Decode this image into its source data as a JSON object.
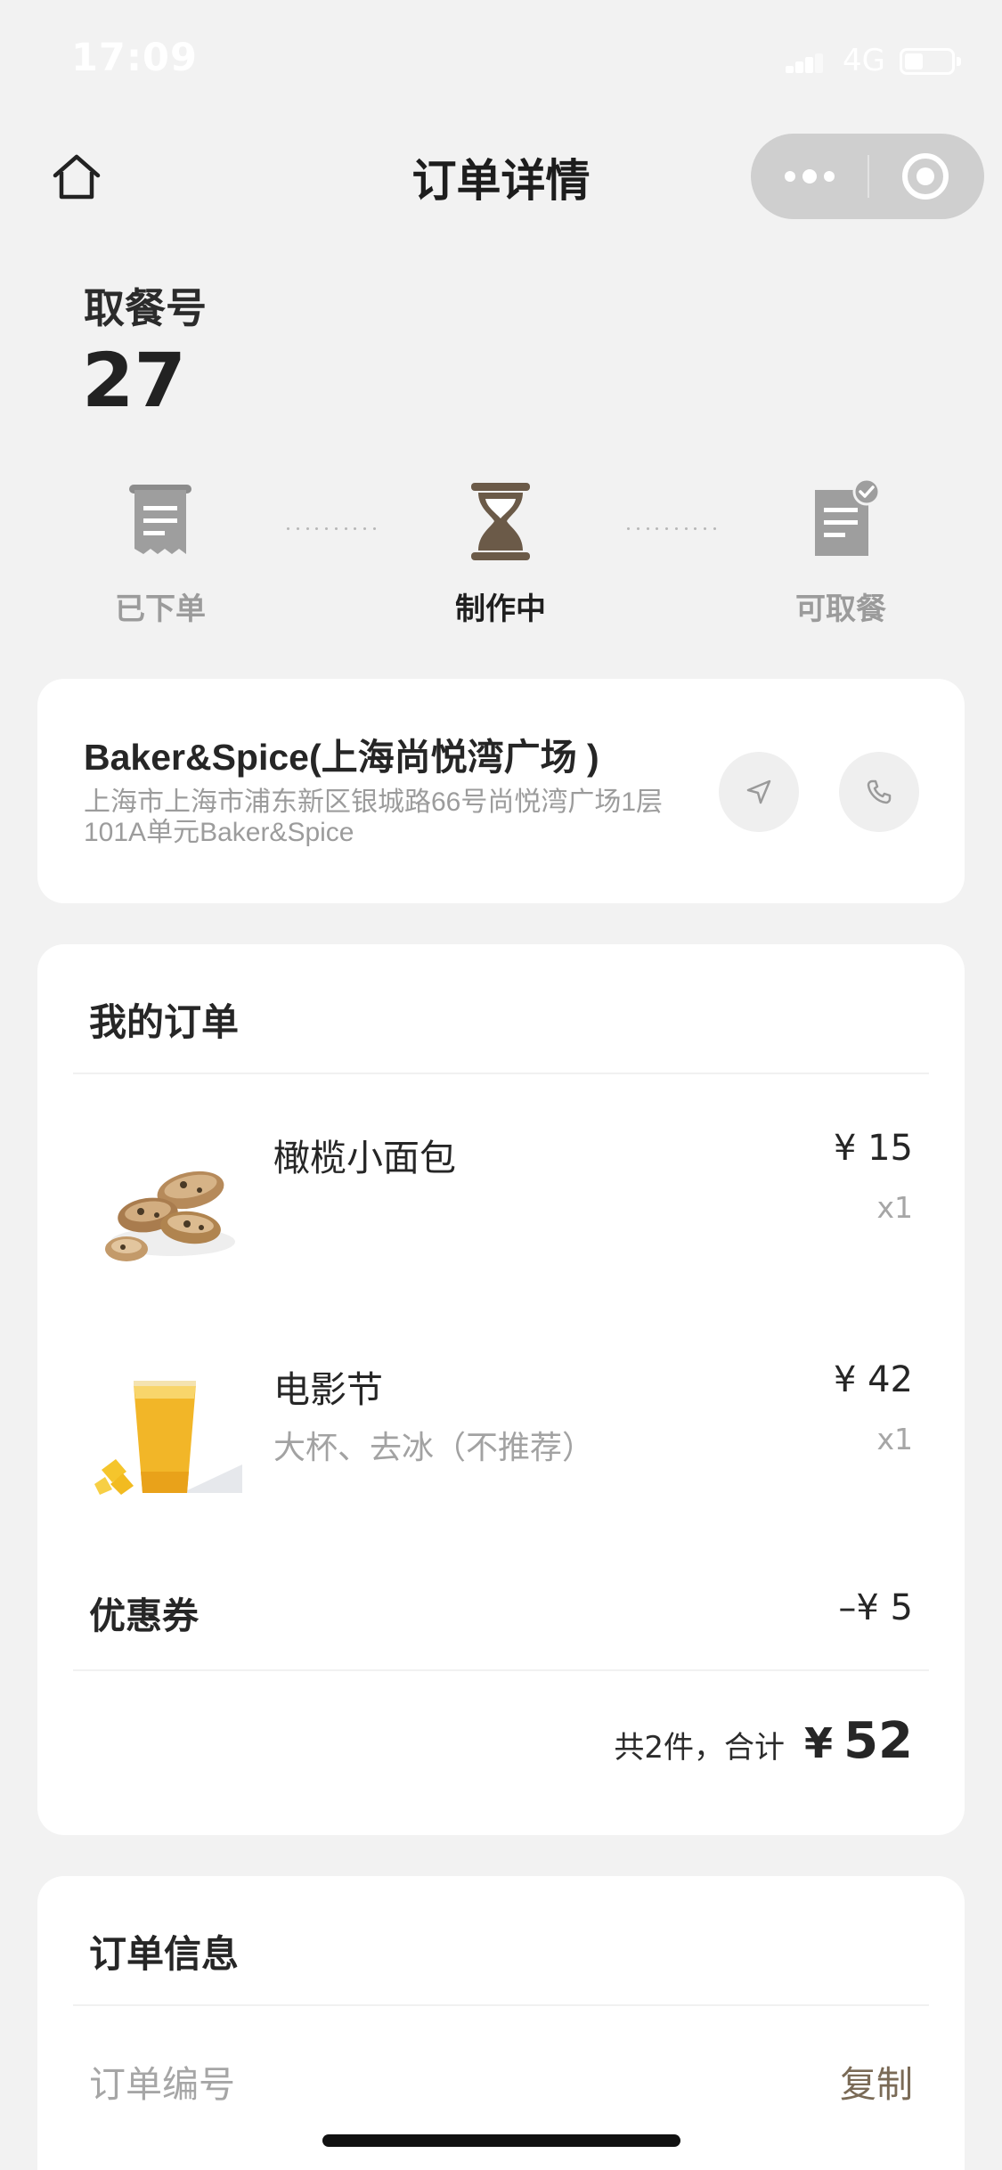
{
  "status_bar": {
    "time": "17:09",
    "network": "4G",
    "battery_level": 0.4
  },
  "nav": {
    "title": "订单详情"
  },
  "pickup": {
    "label": "取餐号",
    "number": "27"
  },
  "steps": [
    {
      "label": "已下单",
      "state": "done"
    },
    {
      "label": "制作中",
      "state": "active"
    },
    {
      "label": "可取餐",
      "state": "pending"
    }
  ],
  "store": {
    "name": "Baker&Spice(上海尚悦湾广场 )",
    "address": "上海市上海市浦东新区银城路66号尚悦湾广场1层101A单元Baker&Spice"
  },
  "order": {
    "title": "我的订单",
    "items": [
      {
        "name": "橄榄小面包",
        "spec": "",
        "price": "¥ 15",
        "qty": "x1",
        "image": "olive-bread-image"
      },
      {
        "name": "电影节",
        "spec": "大杯、去冰（不推荐）",
        "price": "¥ 42",
        "qty": "x1",
        "image": "mango-drink-image"
      }
    ],
    "coupon_label": "优惠券",
    "coupon_value": "–¥ 5",
    "total_text": "共2件，合计",
    "total_currency": "¥",
    "total_amount": "52"
  },
  "info": {
    "title": "订单信息",
    "order_no_label": "订单编号",
    "copy_label": "复制"
  },
  "colors": {
    "accent_brown": "#7a6a56",
    "icon_gray": "#999999",
    "background": "#f2f2f2"
  }
}
